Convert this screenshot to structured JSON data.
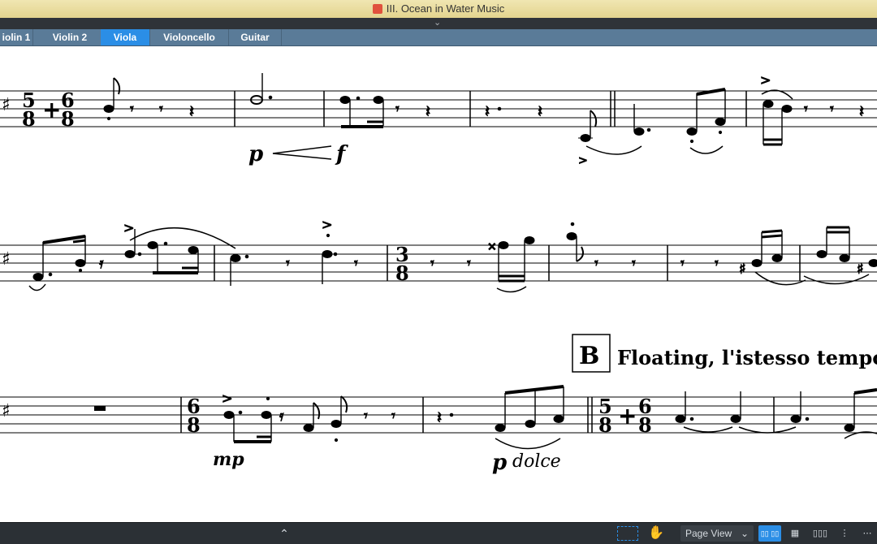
{
  "window": {
    "title": "III. Ocean in Water Music"
  },
  "tabs": [
    {
      "label": "iolin 1",
      "active": false
    },
    {
      "label": "Violin 2",
      "active": false
    },
    {
      "label": "Viola",
      "active": true
    },
    {
      "label": "Violoncello",
      "active": false
    },
    {
      "label": "Guitar",
      "active": false
    }
  ],
  "score": {
    "system1": {
      "time_signature": "5/8+6/8",
      "dynamic_start": "p",
      "dynamic_end": "f"
    },
    "system2": {
      "time_signature": "3/8"
    },
    "system3": {
      "time_signature_1": "6/8",
      "dynamic_1": "mp",
      "dynamic_2": "p",
      "expression_2": "dolce",
      "rehearsal_mark": "B",
      "tempo_text": "Floating, l'istesso tempo",
      "time_signature_2": "5/8+6/8"
    }
  },
  "statusbar": {
    "view_label": "Page View",
    "icons": [
      "collapse-up-icon",
      "selection-tool-icon",
      "hand-tool-icon",
      "view-dropdown-icon",
      "spreads-icon",
      "grid-icon",
      "horizontal-icon",
      "vertical-icon",
      "more-icon"
    ]
  },
  "colors": {
    "active_tab": "#2b8ee6",
    "tabbar": "#5a7b98",
    "titlebar": "#e8d99a",
    "statusbar": "#2b3035"
  }
}
